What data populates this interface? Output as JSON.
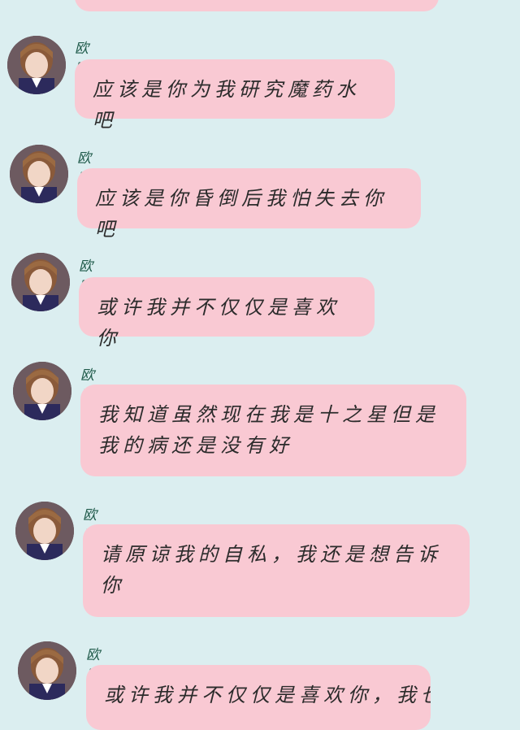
{
  "sender_name": "欧趴",
  "messages": [
    {
      "text": "应该是你为我研究魔药水吧"
    },
    {
      "text": "应该是你昏倒后我怕失去你吧"
    },
    {
      "text": "或许我并不仅仅是喜欢你"
    },
    {
      "text": "我知道虽然现在我是十之星但是我的病还是没有好"
    },
    {
      "text": "请原谅我的自私，我还是想告诉你"
    },
    {
      "text": "或许我并不仅仅是喜欢你，我也爱你"
    }
  ],
  "colors": {
    "background": "#dbeef0",
    "bubble": "#f9c9d3",
    "name": "#1f5a4a"
  }
}
